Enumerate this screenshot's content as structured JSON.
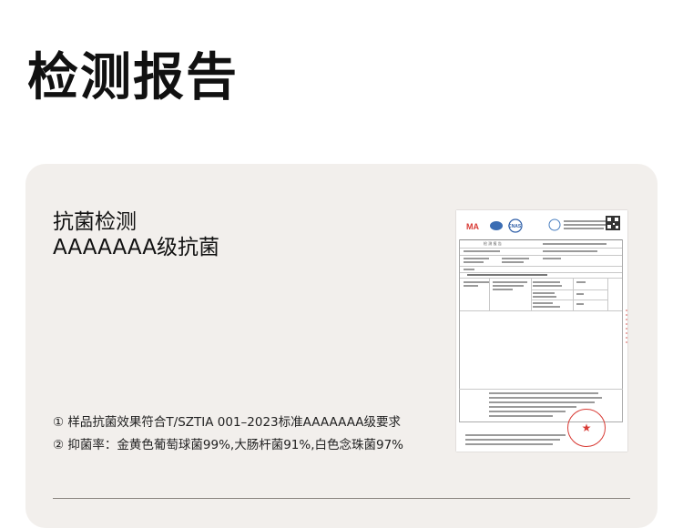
{
  "header": {
    "title": "检测报告"
  },
  "section": {
    "heading_line1": "抗菌检测",
    "heading_line2": "AAAAAAA级抗菌"
  },
  "notes": [
    "① 样品抗菌效果符合T/SZTIA 001–2023标准AAAAAAA级要求",
    "② 抑菌率：金黄色葡萄球菌99%,大肠杆菌91%,白色念珠菌97%"
  ],
  "report": {
    "logo_cma": "MA",
    "logo_cnas": "CNAS",
    "table_heading": "检 测 报 告",
    "stamp_icon": "star-icon"
  },
  "colors": {
    "card_bg": "#f2efec",
    "stamp_red": "#d83a34"
  }
}
